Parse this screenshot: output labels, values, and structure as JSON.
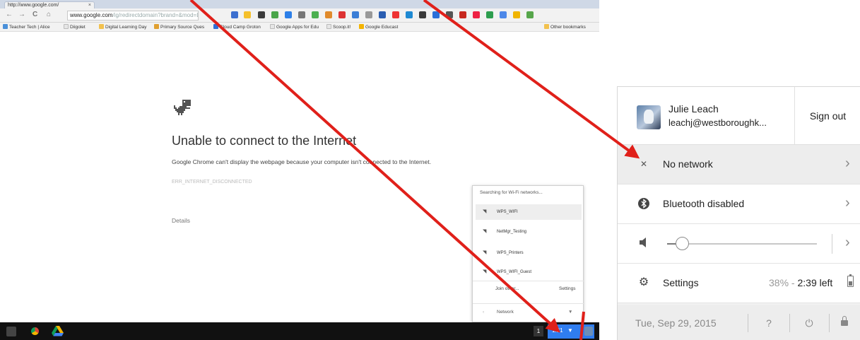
{
  "browser": {
    "tab_title": "http://www.google.com/",
    "nav": {
      "back": "←",
      "forward": "→",
      "reload": "C",
      "home": "⌂"
    },
    "url_host": "www.google.com",
    "url_path": "/ig/redirectdomain?brand=&mod=LENP",
    "bookmarks": [
      {
        "label": "Teacher Tech | Alice",
        "color": "#4a90d9"
      },
      {
        "label": "Diigolet",
        "color": "#d9d9d9"
      },
      {
        "label": "Digital Learning Day",
        "color": "#f2c14e"
      },
      {
        "label": "Primary Source Ques",
        "color": "#e0a030"
      },
      {
        "label": "Cloud Camp Groton",
        "color": "#2f6fd6"
      },
      {
        "label": "Google Apps for Edu",
        "color": "#d9d9d9"
      },
      {
        "label": "Scoop.it!",
        "color": "#d9d9d9"
      },
      {
        "label": "Google Educast",
        "color": "#f4b400"
      },
      {
        "label": "Other bookmarks",
        "color": "#f2c14e"
      }
    ]
  },
  "error_page": {
    "title": "Unable to connect to the Internet",
    "message": "Google Chrome can't display the webpage because your computer isn't connected to the Internet.",
    "code": "ERR_INTERNET_DISCONNECTED",
    "details": "Details"
  },
  "wifi_popup": {
    "header": "Searching for Wi-Fi networks...",
    "networks": [
      "WPS_WIFI",
      "NetMgr_Testing",
      "WPS_Printers",
      "WPS_WIFI_Guest"
    ],
    "join_other": "Join other...",
    "settings": "Settings",
    "back_label": "Network"
  },
  "shelf": {
    "notification_count": "1",
    "time": "1:21"
  },
  "tray": {
    "user_name": "Julie Leach",
    "user_email": "leachj@westboroughk...",
    "sign_out": "Sign out",
    "network_label": "No network",
    "bluetooth_label": "Bluetooth disabled",
    "volume_level": 0.1,
    "settings_label": "Settings",
    "battery_percent": "38%",
    "battery_sep": " - ",
    "battery_time": "2:39 left",
    "date": "Tue, Sep 29, 2015",
    "help_glyph": "?",
    "power_glyph": "⏻"
  },
  "colors": {
    "arrow": "#e0201a",
    "status_area": "#2f7df0",
    "shelf": "#111111"
  }
}
